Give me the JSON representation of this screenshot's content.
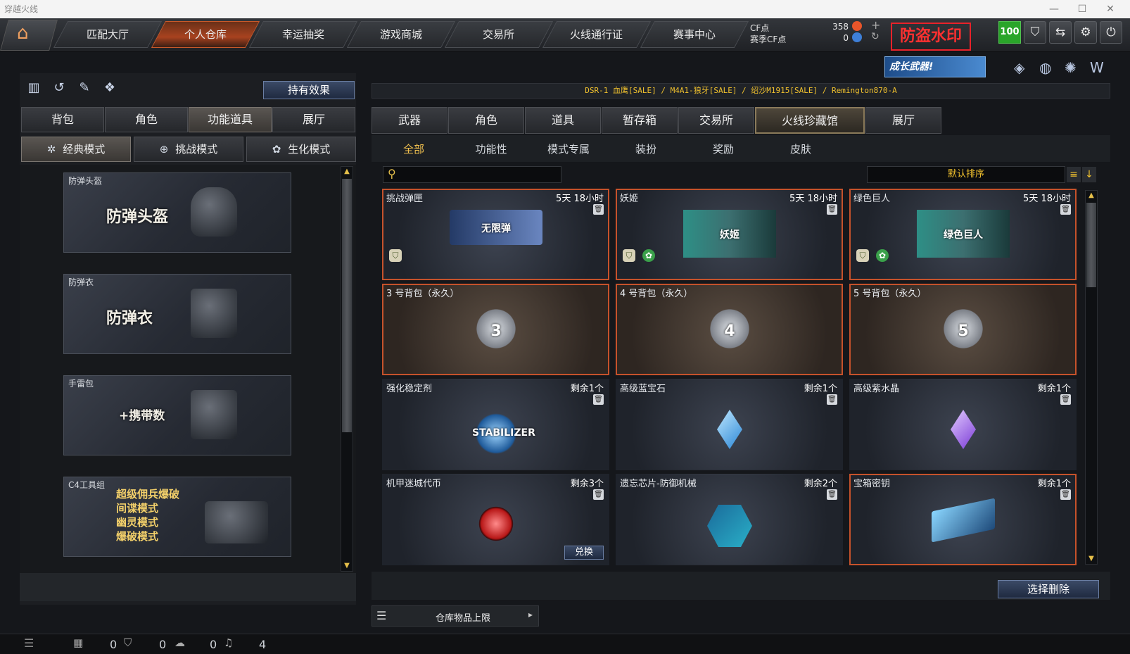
{
  "window": {
    "title": "穿越火线"
  },
  "nav": {
    "tabs": [
      "匹配大厅",
      "个人仓库",
      "幸运抽奖",
      "游戏商城",
      "交易所",
      "火线通行证",
      "赛事中心"
    ],
    "active": 1
  },
  "currency": {
    "cf_label": "CF点",
    "cf_value": "358",
    "season_label": "赛季CF点",
    "season_value": "0"
  },
  "banner": {
    "mod_seal": "防盗水印",
    "promo": "成长武器!",
    "level": "100"
  },
  "left": {
    "effects_button": "持有效果",
    "tabs": [
      "背包",
      "角色",
      "功能道具",
      "展厅"
    ],
    "active_tab": 2,
    "modes": [
      "经典模式",
      "挑战模式",
      "生化模式"
    ],
    "active_mode": 0,
    "cards": [
      {
        "label": "防弹头盔",
        "art": "防弹头盔"
      },
      {
        "label": "防弹衣",
        "art": "防弹衣"
      },
      {
        "label": "手雷包",
        "art": "+携带数"
      },
      {
        "label": "C4工具组",
        "art_lines": [
          "超级佣兵爆破",
          "间谍模式",
          "幽灵模式",
          "爆破模式"
        ]
      }
    ]
  },
  "right": {
    "ticker": "DSR-1 血鹰[SALE] / M4A1-狼牙[SALE] / 绍沙M1915[SALE] / Remington870-A",
    "tabs": [
      "武器",
      "角色",
      "道具",
      "暂存箱",
      "交易所",
      "火线珍藏馆",
      "展厅"
    ],
    "active_tab": 5,
    "subtabs": [
      "全部",
      "功能性",
      "模式专属",
      "装扮",
      "奖励",
      "皮肤"
    ],
    "active_subtab": 0,
    "search": {
      "placeholder": ""
    },
    "sort": "默认排序",
    "items": [
      {
        "name": "挑战弹匣",
        "time": "5天 18小时",
        "art": "无限弹",
        "icon": "ammo-icon",
        "sel": true
      },
      {
        "name": "妖姬",
        "time": "5天 18小时",
        "art": "妖姬",
        "icon": "character-icon",
        "sel": true
      },
      {
        "name": "绿色巨人",
        "time": "5天 18小时",
        "art": "绿色巨人",
        "icon": "character-icon",
        "sel": true
      },
      {
        "name": "3 号背包（永久）",
        "time": "",
        "art": "3",
        "icon": "bag-icon",
        "sel": true
      },
      {
        "name": "4 号背包（永久）",
        "time": "",
        "art": "4",
        "icon": "bag-icon",
        "sel": true
      },
      {
        "name": "5 号背包（永久）",
        "time": "",
        "art": "5",
        "icon": "bag-icon",
        "sel": true
      },
      {
        "name": "强化稳定剂",
        "time": "剩余1个",
        "art": "STABILIZER",
        "icon": "stabilizer-icon",
        "sel": false
      },
      {
        "name": "高级蓝宝石",
        "time": "剩余1个",
        "art": "",
        "icon": "blue-gem-icon",
        "sel": false
      },
      {
        "name": "高级紫水晶",
        "time": "剩余1个",
        "art": "",
        "icon": "purple-gem-icon",
        "sel": false
      },
      {
        "name": "机甲迷城代币",
        "time": "剩余3个",
        "art": "",
        "icon": "token-icon",
        "sel": false,
        "action": "兑换"
      },
      {
        "name": "遗忘芯片-防御机械",
        "time": "剩余2个",
        "art": "",
        "icon": "chip-icon",
        "sel": false
      },
      {
        "name": "宝箱密钥",
        "time": "剩余1个",
        "art": "",
        "icon": "key-icon",
        "sel": true
      }
    ],
    "delete_button": "选择删除",
    "capacity_label": "仓库物品上限"
  },
  "status": {
    "values": [
      "0",
      "0",
      "0",
      "4"
    ]
  }
}
